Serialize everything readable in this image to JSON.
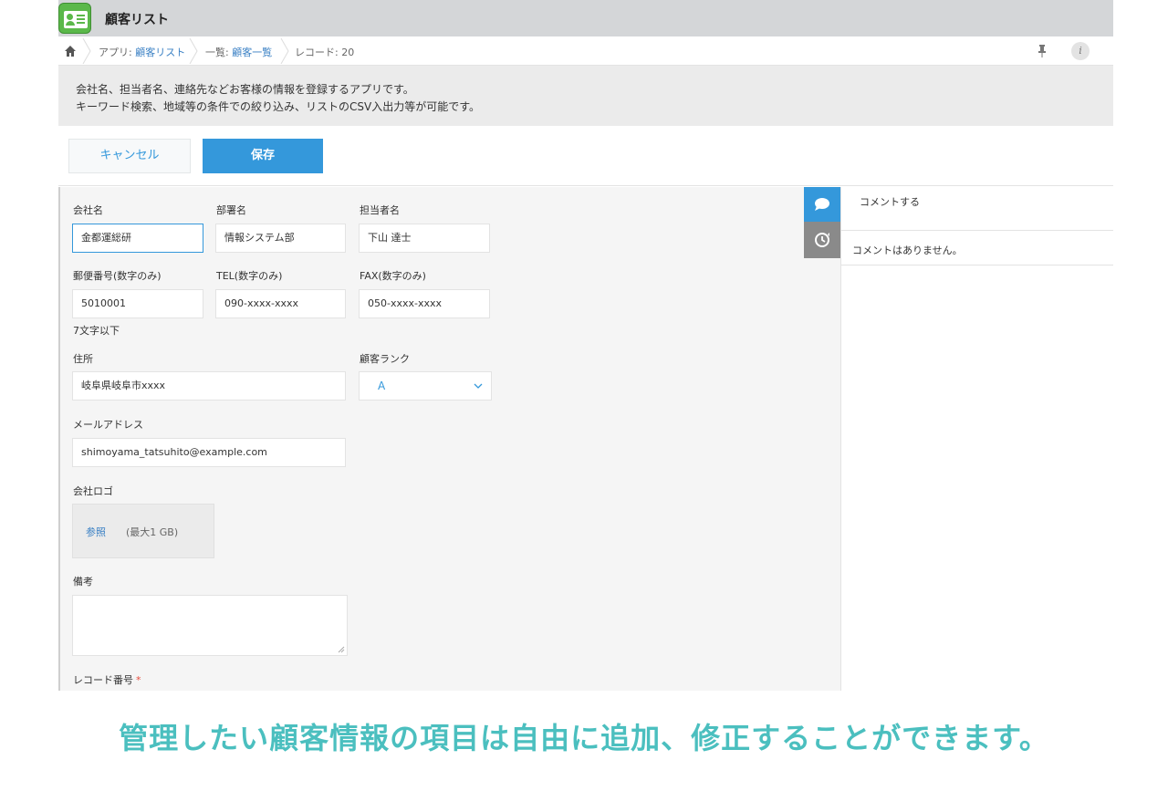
{
  "app": {
    "title": "顧客リスト"
  },
  "breadcrumb": {
    "app_prefix": "アプリ: ",
    "app_name": "顧客リスト",
    "view_prefix": "一覧: ",
    "view_name": "顧客一覧",
    "record": "レコード: 20"
  },
  "description": {
    "line1": "会社名、担当者名、連絡先などお客様の情報を登録するアプリです。",
    "line2": "キーワード検索、地域等の条件での絞り込み、リストのCSV入出力等が可能です。"
  },
  "actions": {
    "cancel_label": "キャンセル",
    "save_label": "保存"
  },
  "form": {
    "company": {
      "label": "会社名",
      "value": "金都運総研"
    },
    "department": {
      "label": "部署名",
      "value": "情報システム部"
    },
    "contact": {
      "label": "担当者名",
      "value": "下山 達士"
    },
    "zip": {
      "label": "郵便番号(数字のみ)",
      "value": "5010001",
      "hint": "7文字以下"
    },
    "tel": {
      "label": "TEL(数字のみ)",
      "value": "090-xxxx-xxxx"
    },
    "fax": {
      "label": "FAX(数字のみ)",
      "value": "050-xxxx-xxxx"
    },
    "address": {
      "label": "住所",
      "value": "岐阜県岐阜市xxxx"
    },
    "rank": {
      "label": "顧客ランク",
      "value": "A"
    },
    "email": {
      "label": "メールアドレス",
      "value": "shimoyama_tatsuhito@example.com"
    },
    "logo": {
      "label": "会社ロゴ",
      "browse": "参照",
      "limit": "(最大1 GB)"
    },
    "notes": {
      "label": "備考",
      "value": ""
    },
    "record_number": {
      "label": "レコード番号",
      "required_mark": "*"
    }
  },
  "comments": {
    "placeholder": "コメントする",
    "empty": "コメントはありません。"
  },
  "caption": "管理したい顧客情報の項目は自由に追加、修正することができます。",
  "colors": {
    "accent": "#3498db",
    "brand_green": "#5bb84a",
    "caption": "#4bbfbf",
    "required": "#e74c3c"
  }
}
